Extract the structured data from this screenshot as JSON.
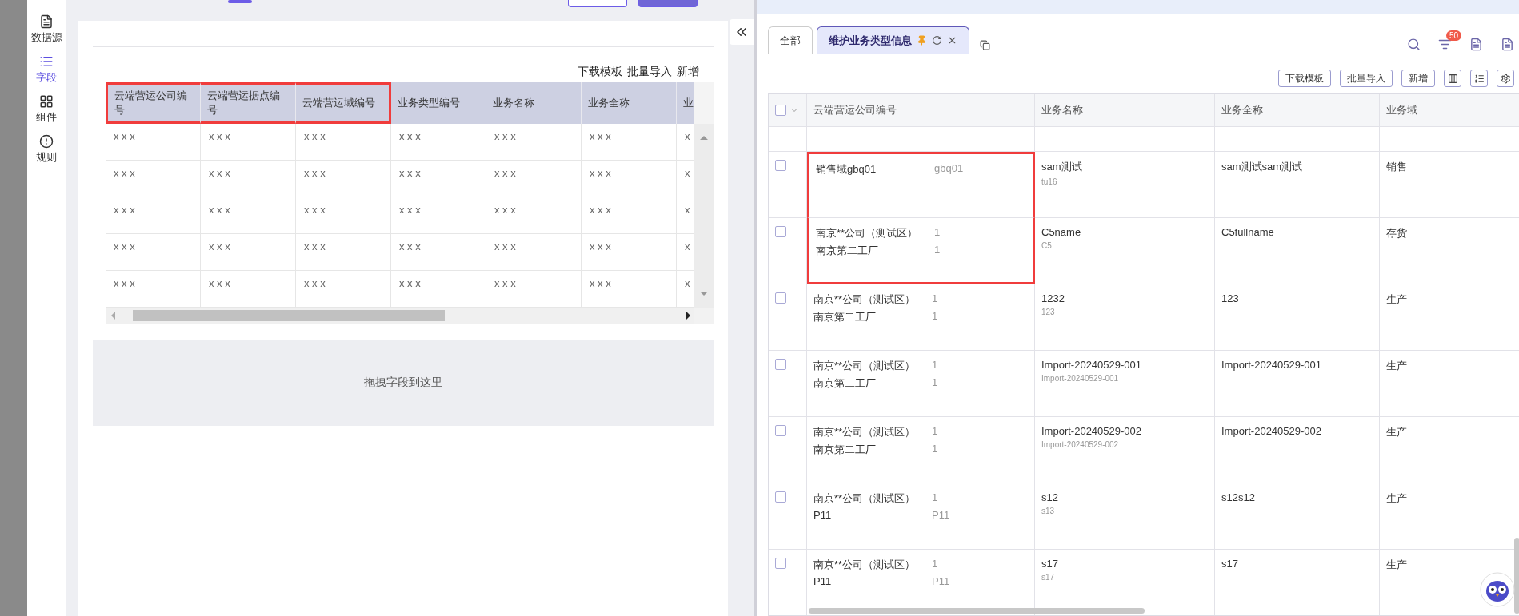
{
  "sidebar": {
    "items": [
      {
        "label": "数据源",
        "kind": "source",
        "selected": false
      },
      {
        "label": "字段",
        "kind": "fields",
        "selected": true
      },
      {
        "label": "组件",
        "kind": "components",
        "selected": false
      },
      {
        "label": "规则",
        "kind": "rules",
        "selected": false
      }
    ]
  },
  "designer": {
    "actions": [
      "下载模板",
      "批量导入",
      "新增"
    ],
    "table": {
      "columns": [
        {
          "label": "云端营运公司编号",
          "highlighted": true
        },
        {
          "label": "云端营运据点编号",
          "highlighted": true
        },
        {
          "label": "云端营运域编号",
          "highlighted": true
        },
        {
          "label": "业务类型编号",
          "highlighted": false
        },
        {
          "label": "业务名称",
          "highlighted": false
        },
        {
          "label": "业务全称",
          "highlighted": false
        },
        {
          "label": "业",
          "highlighted": false
        }
      ],
      "rows": [
        [
          "x x x",
          "x x x",
          "x x x",
          "x x x",
          "x x x",
          "x x x",
          "x"
        ],
        [
          "x x x",
          "x x x",
          "x x x",
          "x x x",
          "x x x",
          "x x x",
          "x"
        ],
        [
          "x x x",
          "x x x",
          "x x x",
          "x x x",
          "x x x",
          "x x x",
          "x"
        ],
        [
          "x x x",
          "x x x",
          "x x x",
          "x x x",
          "x x x",
          "x x x",
          "x"
        ],
        [
          "x x x",
          "x x x",
          "x x x",
          "x x x",
          "x x x",
          "x x x",
          "x"
        ]
      ]
    },
    "dropzone": "拖拽字段到这里"
  },
  "app": {
    "tabs": [
      {
        "label": "全部",
        "selected": false,
        "pinned": false
      },
      {
        "label": "维护业务类型信息",
        "selected": true,
        "pinned": true
      }
    ],
    "badge": "50",
    "actions": [
      "下载模板",
      "批量导入",
      "新增"
    ],
    "table": {
      "columns": [
        "云端营运公司编号",
        "业务名称",
        "业务全称",
        "业务域"
      ],
      "header_checked": false,
      "rows": [
        {
          "checked": false,
          "highlighted": true,
          "company": "销售域gbq01",
          "company_code": "gbq01",
          "name": "sam测试",
          "code": "tu16",
          "full_name": "sam测试sam测试",
          "domain": "销售"
        },
        {
          "checked": false,
          "highlighted": true,
          "company": "南京**公司（测试区）",
          "company_code": "1",
          "plant": "南京第二工厂",
          "plant_code": "1",
          "name": "C5name",
          "code": "C5",
          "full_name": "C5fullname",
          "domain": "存货"
        },
        {
          "checked": false,
          "highlighted": false,
          "company": "南京**公司（测试区）",
          "company_code": "1",
          "plant": "南京第二工厂",
          "plant_code": "1",
          "name": "1232",
          "code": "123",
          "full_name": "123",
          "domain": "生产"
        },
        {
          "checked": false,
          "highlighted": false,
          "company": "南京**公司（测试区）",
          "company_code": "1",
          "plant": "南京第二工厂",
          "plant_code": "1",
          "name": "Import-20240529-001",
          "code": "Import-20240529-001",
          "full_name": "Import-20240529-001",
          "domain": "生产"
        },
        {
          "checked": false,
          "highlighted": false,
          "company": "南京**公司（测试区）",
          "company_code": "1",
          "plant": "南京第二工厂",
          "plant_code": "1",
          "name": "Import-20240529-002",
          "code": "Import-20240529-002",
          "full_name": "Import-20240529-002",
          "domain": "生产"
        },
        {
          "checked": false,
          "highlighted": false,
          "company": "南京**公司（测试区）",
          "company_code": "1",
          "plant": "P11",
          "plant_code": "P11",
          "name": "s12",
          "code": "s13",
          "full_name": "s12s12",
          "domain": "生产"
        },
        {
          "checked": false,
          "highlighted": false,
          "company": "南京**公司（测试区）",
          "company_code": "1",
          "plant": "P11",
          "plant_code": "P11",
          "name": "s17",
          "code": "s17",
          "full_name": "s17",
          "domain": "生产"
        }
      ]
    }
  }
}
